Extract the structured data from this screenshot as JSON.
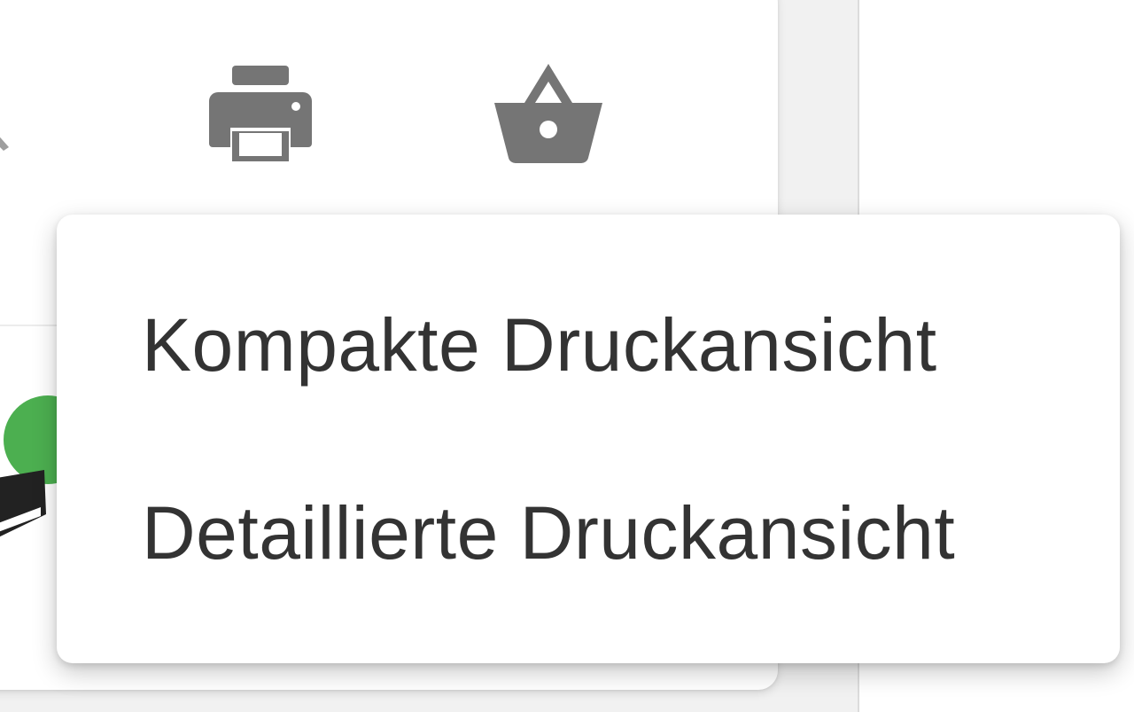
{
  "toolbar": {
    "icons": [
      "print-icon",
      "shopping-basket-icon"
    ],
    "icon_color": "#757575"
  },
  "print_menu": {
    "items": [
      {
        "label": "Kompakte Druckansicht"
      },
      {
        "label": "Detaillierte Druckansicht"
      }
    ],
    "text_color": "#333333"
  },
  "status": {
    "color": "#4caf50"
  }
}
